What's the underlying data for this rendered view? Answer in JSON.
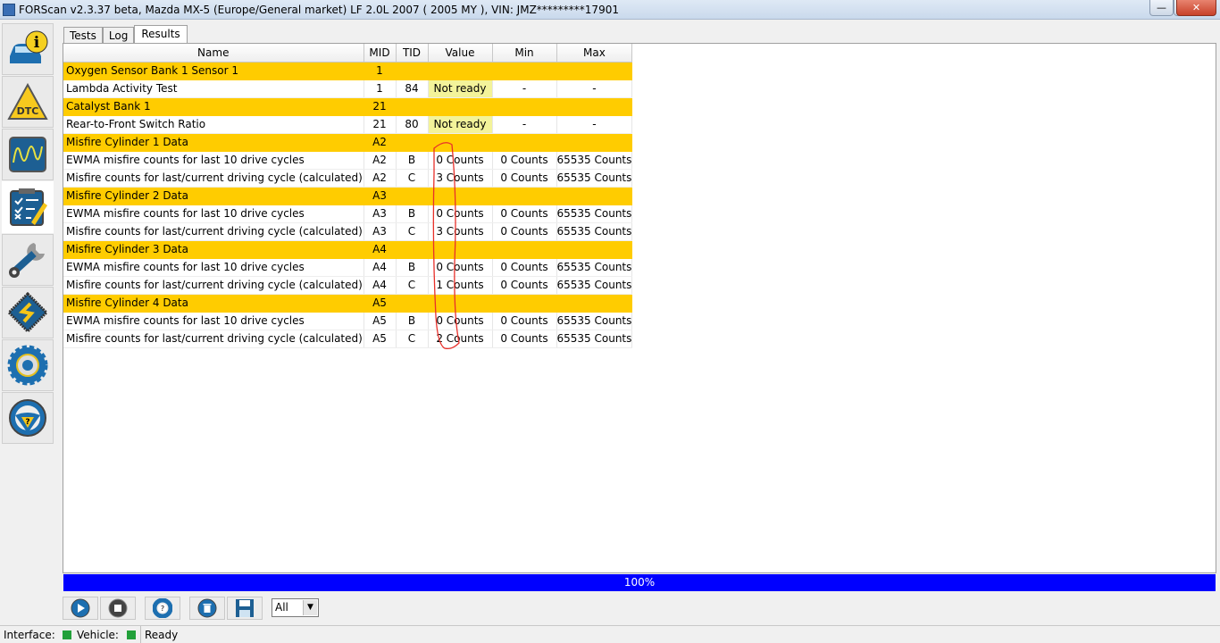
{
  "window": {
    "title": "FORScan v2.3.37 beta, Mazda MX-5 (Europe/General market) LF 2.0L 2007 ( 2005 MY ), VIN: JMZ*********17901"
  },
  "sidebar": {
    "items": [
      {
        "name": "vehicle-info",
        "icon": "car-info-icon"
      },
      {
        "name": "dtc",
        "icon": "dtc-warning-icon"
      },
      {
        "name": "oscilloscope",
        "icon": "oscilloscope-icon"
      },
      {
        "name": "tests",
        "icon": "checklist-icon",
        "active": true
      },
      {
        "name": "service",
        "icon": "wrench-icon"
      },
      {
        "name": "configuration",
        "icon": "chip-icon"
      },
      {
        "name": "settings",
        "icon": "gear-icon"
      },
      {
        "name": "help",
        "icon": "steering-help-icon"
      }
    ]
  },
  "tabs": [
    {
      "label": "Tests"
    },
    {
      "label": "Log"
    },
    {
      "label": "Results",
      "selected": true
    }
  ],
  "table": {
    "columns": [
      "Name",
      "MID",
      "TID",
      "Value",
      "Min",
      "Max"
    ],
    "rows": [
      {
        "group": true,
        "name": "Oxygen Sensor Bank 1 Sensor 1",
        "mid": "1",
        "tid": "",
        "value": "",
        "min": "",
        "max": ""
      },
      {
        "name": "Lambda Activity Test",
        "mid": "1",
        "tid": "84",
        "value": "Not ready",
        "min": "-",
        "max": "-",
        "notready": true
      },
      {
        "group": true,
        "name": "Catalyst Bank 1",
        "mid": "21",
        "tid": "",
        "value": "",
        "min": "",
        "max": ""
      },
      {
        "name": "Rear-to-Front Switch Ratio",
        "mid": "21",
        "tid": "80",
        "value": "Not ready",
        "min": "-",
        "max": "-",
        "notready": true
      },
      {
        "group": true,
        "name": "Misfire Cylinder 1 Data",
        "mid": "A2",
        "tid": "",
        "value": "",
        "min": "",
        "max": ""
      },
      {
        "name": "EWMA misfire counts for last 10 drive cycles",
        "mid": "A2",
        "tid": "B",
        "value": "0 Counts",
        "min": "0 Counts",
        "max": "65535 Counts"
      },
      {
        "name": "Misfire counts for last/current driving cycle (calculated)",
        "mid": "A2",
        "tid": "C",
        "value": "3 Counts",
        "min": "0 Counts",
        "max": "65535 Counts"
      },
      {
        "group": true,
        "name": "Misfire Cylinder 2 Data",
        "mid": "A3",
        "tid": "",
        "value": "",
        "min": "",
        "max": ""
      },
      {
        "name": "EWMA misfire counts for last 10 drive cycles",
        "mid": "A3",
        "tid": "B",
        "value": "0 Counts",
        "min": "0 Counts",
        "max": "65535 Counts"
      },
      {
        "name": "Misfire counts for last/current driving cycle (calculated)",
        "mid": "A3",
        "tid": "C",
        "value": "3 Counts",
        "min": "0 Counts",
        "max": "65535 Counts"
      },
      {
        "group": true,
        "name": "Misfire Cylinder 3 Data",
        "mid": "A4",
        "tid": "",
        "value": "",
        "min": "",
        "max": ""
      },
      {
        "name": "EWMA misfire counts for last 10 drive cycles",
        "mid": "A4",
        "tid": "B",
        "value": "0 Counts",
        "min": "0 Counts",
        "max": "65535 Counts"
      },
      {
        "name": "Misfire counts for last/current driving cycle (calculated)",
        "mid": "A4",
        "tid": "C",
        "value": "1 Counts",
        "min": "0 Counts",
        "max": "65535 Counts"
      },
      {
        "group": true,
        "name": "Misfire Cylinder 4 Data",
        "mid": "A5",
        "tid": "",
        "value": "",
        "min": "",
        "max": ""
      },
      {
        "name": "EWMA misfire counts for last 10 drive cycles",
        "mid": "A5",
        "tid": "B",
        "value": "0 Counts",
        "min": "0 Counts",
        "max": "65535 Counts"
      },
      {
        "name": "Misfire counts for last/current driving cycle (calculated)",
        "mid": "A5",
        "tid": "C",
        "value": "2 Counts",
        "min": "0 Counts",
        "max": "65535 Counts"
      }
    ]
  },
  "progress": {
    "label": "100%",
    "value": 100
  },
  "toolbar": {
    "filter_value": "All",
    "buttons": [
      "play-icon",
      "stop-icon",
      "lifebuoy-help-icon",
      "delete-icon",
      "save-icon"
    ]
  },
  "status": {
    "interface_label": "Interface:",
    "vehicle_label": "Vehicle:",
    "message": "Ready",
    "interface_color": "#22a03a",
    "vehicle_color": "#22a03a"
  },
  "colors": {
    "group_row": "#ffcc00",
    "not_ready": "#f3f39a",
    "progress": "#0000ff",
    "annotation": "#e8302a"
  }
}
